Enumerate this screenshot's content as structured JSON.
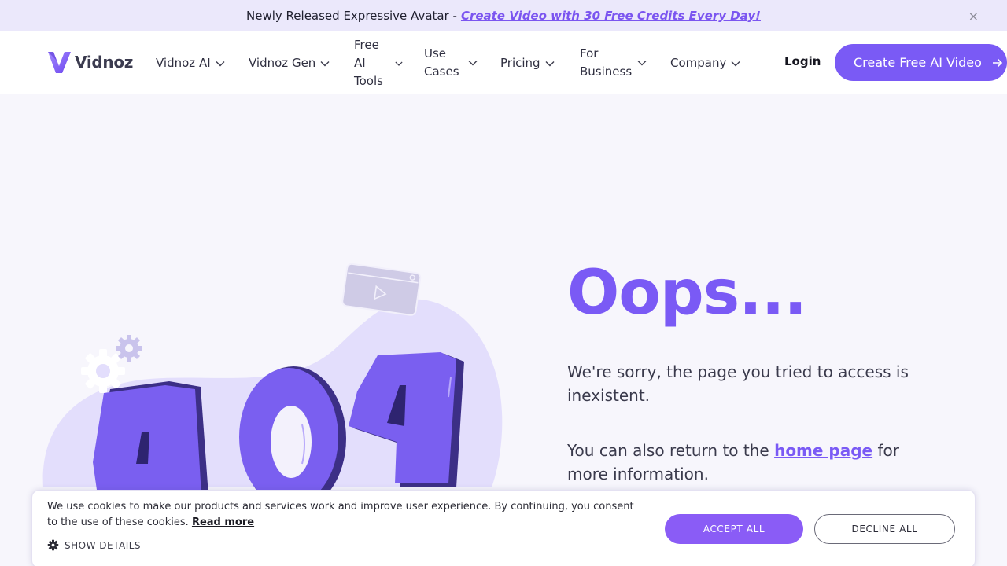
{
  "announcement": {
    "lead": "Newly Released Expressive Avatar -",
    "link": "Create Video with 30 Free Credits Every Day!",
    "close": "×"
  },
  "nav": {
    "logo_text": "Vidnoz",
    "items": [
      {
        "label": "Vidnoz AI"
      },
      {
        "label": "Vidnoz Gen"
      },
      {
        "label": "Free AI Tools"
      },
      {
        "label": "Use Cases"
      },
      {
        "label": "Pricing"
      },
      {
        "label": "For Business"
      },
      {
        "label": "Company"
      }
    ],
    "login": "Login",
    "cta": "Create Free AI Video"
  },
  "error": {
    "title": "Oops...",
    "message": "We're sorry, the page you tried to access is inexistent.",
    "return_pre": "You can also return to the",
    "return_link": "home page",
    "return_post": "for more information.",
    "illustration_text": "404"
  },
  "cookie": {
    "text": "We use cookies to make our products and services work and improve user experience. By continuing, you consent to the use of these cookies.",
    "read_more": "Read more",
    "show_details": "SHOW DETAILS",
    "accept": "ACCEPT ALL",
    "decline": "DECLINE ALL"
  },
  "colors": {
    "accent": "#7a5af5",
    "announcement_bg": "#ebe8fb",
    "page_bg": "#f7f6fc"
  },
  "icons": [
    "close-icon",
    "logo-icon",
    "chevron-down-icon",
    "arrow-right-icon",
    "gear-icon",
    "video-card-icon",
    "play-icon"
  ]
}
